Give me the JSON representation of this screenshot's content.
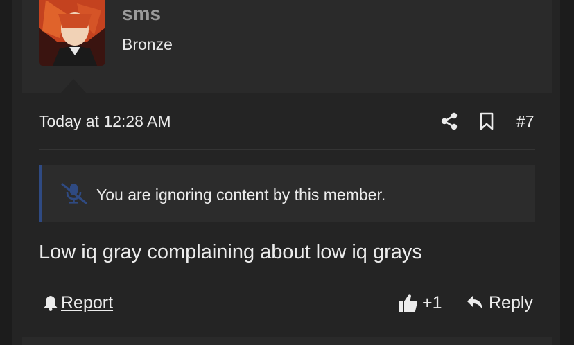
{
  "user": {
    "name": "sms",
    "title": "Bronze"
  },
  "post": {
    "timestamp": "Today at 12:28 AM",
    "number": "#7",
    "ignored_notice": "You are ignoring content by this member.",
    "body": "Low iq gray complaining about low iq grays"
  },
  "actions": {
    "report_label": "Report",
    "like_count": "+1",
    "reply_label": "Reply"
  },
  "icons": {
    "share": "share-icon",
    "bookmark": "bookmark-icon",
    "mute": "microphone-slash-icon",
    "report": "bell-icon",
    "like": "thumbs-up-icon",
    "reply": "reply-arrow-icon"
  },
  "colors": {
    "notice_accent": "#2f4a82",
    "username": "#9a9a9a"
  }
}
